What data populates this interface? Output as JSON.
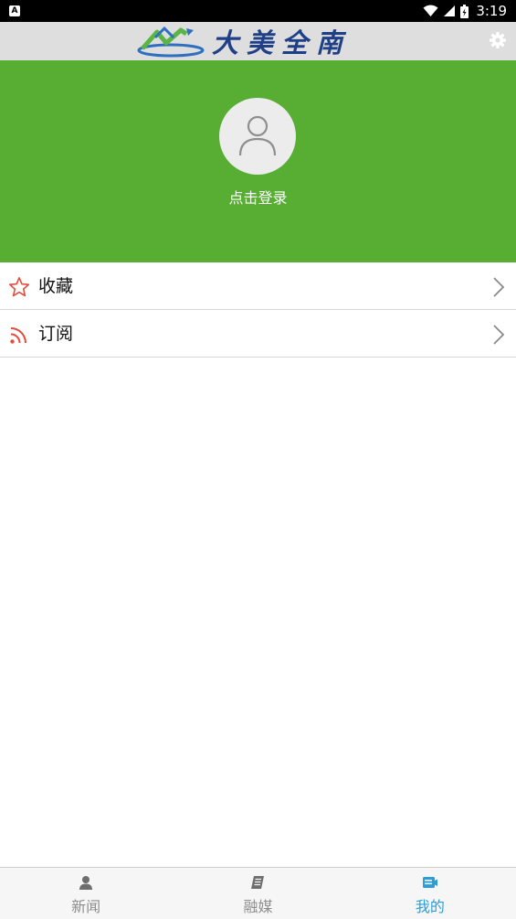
{
  "status_bar": {
    "time": "3:19",
    "notification_icon": "android-a-icon",
    "icons": [
      "wifi-icon",
      "signal-icon",
      "battery-icon"
    ]
  },
  "header": {
    "logo_text": "大美全南",
    "logo_icon": "mountain-logo-icon",
    "settings_icon": "gear-icon"
  },
  "profile": {
    "avatar_icon": "user-avatar-icon",
    "login_label": "点击登录",
    "banner_color": "#58ad33"
  },
  "menu": {
    "items": [
      {
        "label": "收藏",
        "icon": "star-icon",
        "chevron": "chevron-right-icon"
      },
      {
        "label": "订阅",
        "icon": "rss-icon",
        "chevron": "chevron-right-icon"
      }
    ]
  },
  "bottom_nav": {
    "active_color": "#2b9ed8",
    "inactive_color": "#8d8d8d",
    "items": [
      {
        "label": "新闻",
        "icon": "person-icon",
        "active": false
      },
      {
        "label": "融媒",
        "icon": "document-icon",
        "active": false
      },
      {
        "label": "我的",
        "icon": "profile-card-icon",
        "active": true
      }
    ]
  }
}
